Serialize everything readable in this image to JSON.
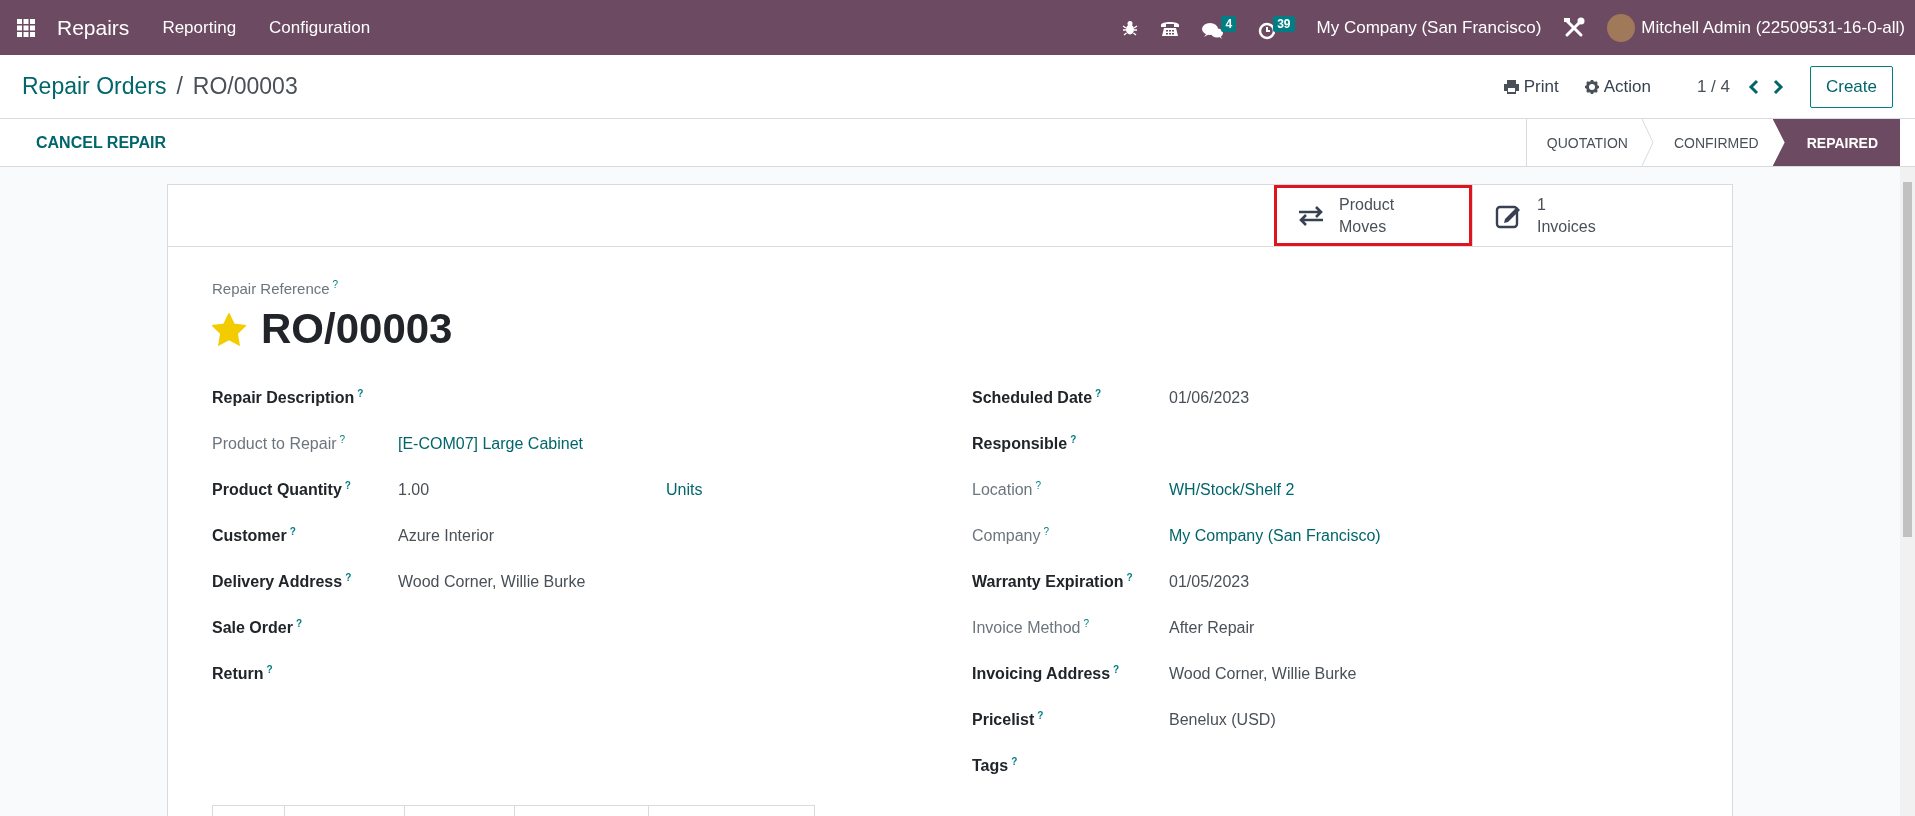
{
  "navbar": {
    "app": "Repairs",
    "menu": [
      "Reporting",
      "Configuration"
    ],
    "messages_badge": "4",
    "activities_badge": "39",
    "company": "My Company (San Francisco)",
    "user": "Mitchell Admin (22509531-16-0-all)"
  },
  "breadcrumb": {
    "parent": "Repair Orders",
    "separator": "/",
    "current": "RO/00003"
  },
  "actions": {
    "print": "Print",
    "action": "Action",
    "pager": "1 / 4",
    "create": "Create"
  },
  "header_button": "CANCEL REPAIR",
  "stages": [
    {
      "label": "QUOTATION",
      "selected": false
    },
    {
      "label": "CONFIRMED",
      "selected": false
    },
    {
      "label": "REPAIRED",
      "selected": true
    }
  ],
  "smart_buttons": [
    {
      "kind": "moves",
      "lines": [
        "Product",
        "Moves"
      ],
      "highlighted": true
    },
    {
      "kind": "invoices",
      "lines": [
        "1",
        "Invoices"
      ],
      "highlighted": false
    }
  ],
  "reference": {
    "label": "Repair Reference",
    "help": "?",
    "name": "RO/00003",
    "starred": true
  },
  "left_fields": [
    {
      "label": "Repair Description",
      "help": "?",
      "muted": false
    },
    {
      "label": "Product to Repair",
      "help": "?",
      "muted": true,
      "value": "[E-COM07] Large Cabinet",
      "link": true
    },
    {
      "label": "Product Quantity",
      "help": "?",
      "muted": false,
      "value": "1.00",
      "link": false,
      "unit": "Units"
    },
    {
      "label": "Customer",
      "help": "?",
      "muted": false,
      "value": "Azure Interior",
      "link": false
    },
    {
      "label": "Delivery Address",
      "help": "?",
      "muted": false,
      "value": "Wood Corner, Willie Burke",
      "link": false
    },
    {
      "label": "Sale Order",
      "help": "?",
      "muted": false
    },
    {
      "label": "Return",
      "help": "?",
      "muted": false
    }
  ],
  "right_fields": [
    {
      "label": "Scheduled Date",
      "help": "?",
      "muted": false,
      "value": "01/06/2023",
      "link": false
    },
    {
      "label": "Responsible",
      "help": "?",
      "muted": false
    },
    {
      "label": "Location",
      "help": "?",
      "muted": true,
      "value": "WH/Stock/Shelf 2",
      "link": true
    },
    {
      "label": "Company",
      "help": "?",
      "muted": true,
      "value": "My Company (San Francisco)",
      "link": true
    },
    {
      "label": "Warranty Expiration",
      "help": "?",
      "muted": false,
      "value": "01/05/2023",
      "link": false
    },
    {
      "label": "Invoice Method",
      "help": "?",
      "muted": true,
      "value": "After Repair",
      "link": false
    },
    {
      "label": "Invoicing Address",
      "help": "?",
      "muted": false,
      "value": "Wood Corner, Willie Burke",
      "link": false
    },
    {
      "label": "Pricelist",
      "help": "?",
      "muted": false,
      "value": "Benelux (USD)",
      "link": false
    },
    {
      "label": "Tags",
      "help": "?",
      "muted": false
    }
  ]
}
